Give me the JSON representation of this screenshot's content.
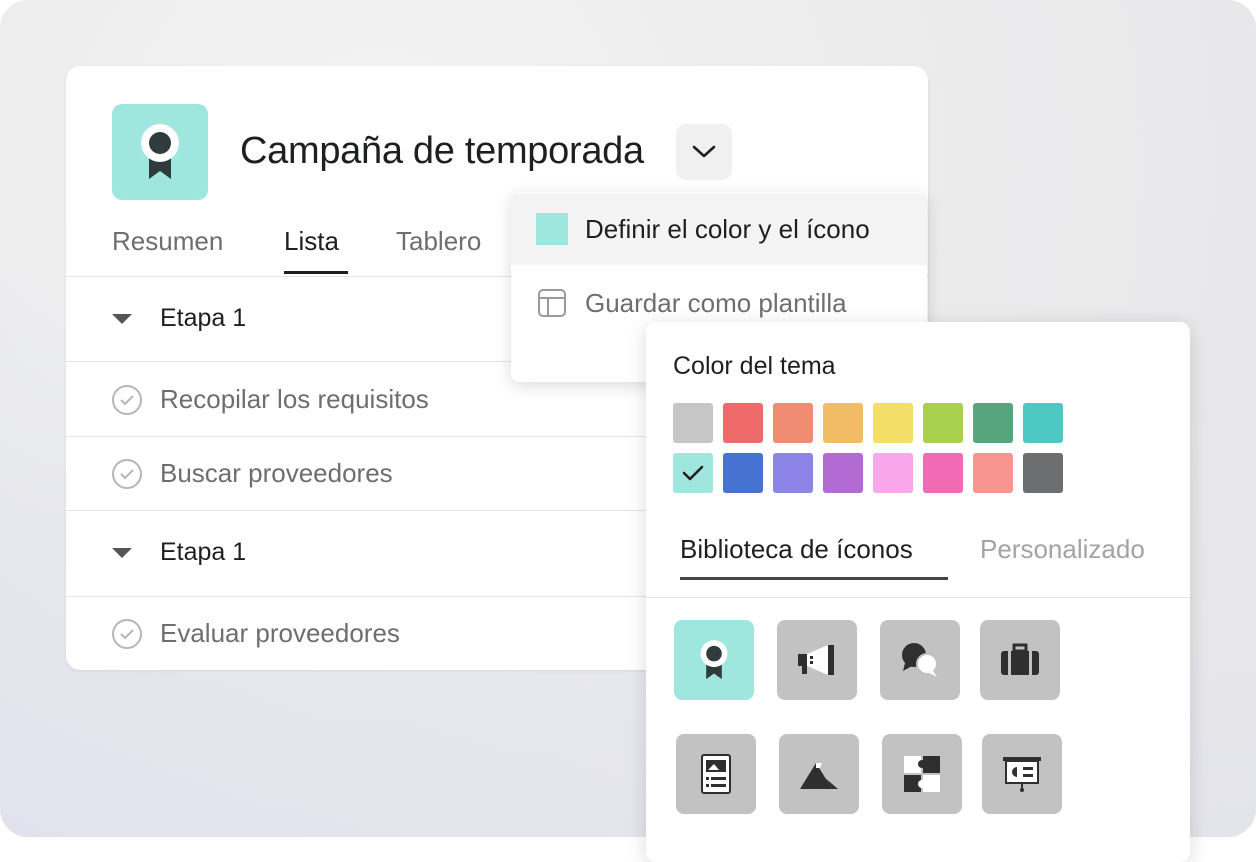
{
  "project": {
    "title": "Campaña de temporada",
    "icon": "award-ribbon-icon",
    "icon_color": "#9fe6df"
  },
  "tabs": [
    {
      "label": "Resumen",
      "active": false
    },
    {
      "label": "Lista",
      "active": true
    },
    {
      "label": "Tablero",
      "active": false
    }
  ],
  "sections": [
    {
      "label": "Etapa 1",
      "tasks": [
        "Recopilar los requisitos",
        "Buscar proveedores"
      ]
    },
    {
      "label": "Etapa 1",
      "tasks": [
        "Evaluar proveedores"
      ]
    }
  ],
  "menu": {
    "items": [
      {
        "label": "Definir el color y el ícono",
        "icon": "color-swatch-icon",
        "highlighted": true
      },
      {
        "label": "Guardar como plantilla",
        "icon": "template-icon",
        "highlighted": false
      }
    ]
  },
  "picker": {
    "title": "Color del tema",
    "colors_row1": [
      "#c7c6c7",
      "#ef6b6b",
      "#ef8c72",
      "#f2bb66",
      "#f3df67",
      "#a9d04f",
      "#56a57c",
      "#4cc7c2"
    ],
    "colors_row2": [
      "#9fe6df",
      "#4673d1",
      "#8d84e8",
      "#b36bd4",
      "#f8a7ea",
      "#f16bb4",
      "#f99490",
      "#6d6e6f"
    ],
    "selected_color": "#9fe6df",
    "tabs": [
      {
        "label": "Biblioteca de íconos",
        "active": true
      },
      {
        "label": "Personalizado",
        "active": false
      }
    ],
    "icons": [
      "award-ribbon-icon",
      "megaphone-icon",
      "chat-bubbles-icon",
      "briefcase-icon",
      "document-image-icon",
      "mountain-flag-icon",
      "puzzle-icon",
      "presentation-icon"
    ]
  }
}
